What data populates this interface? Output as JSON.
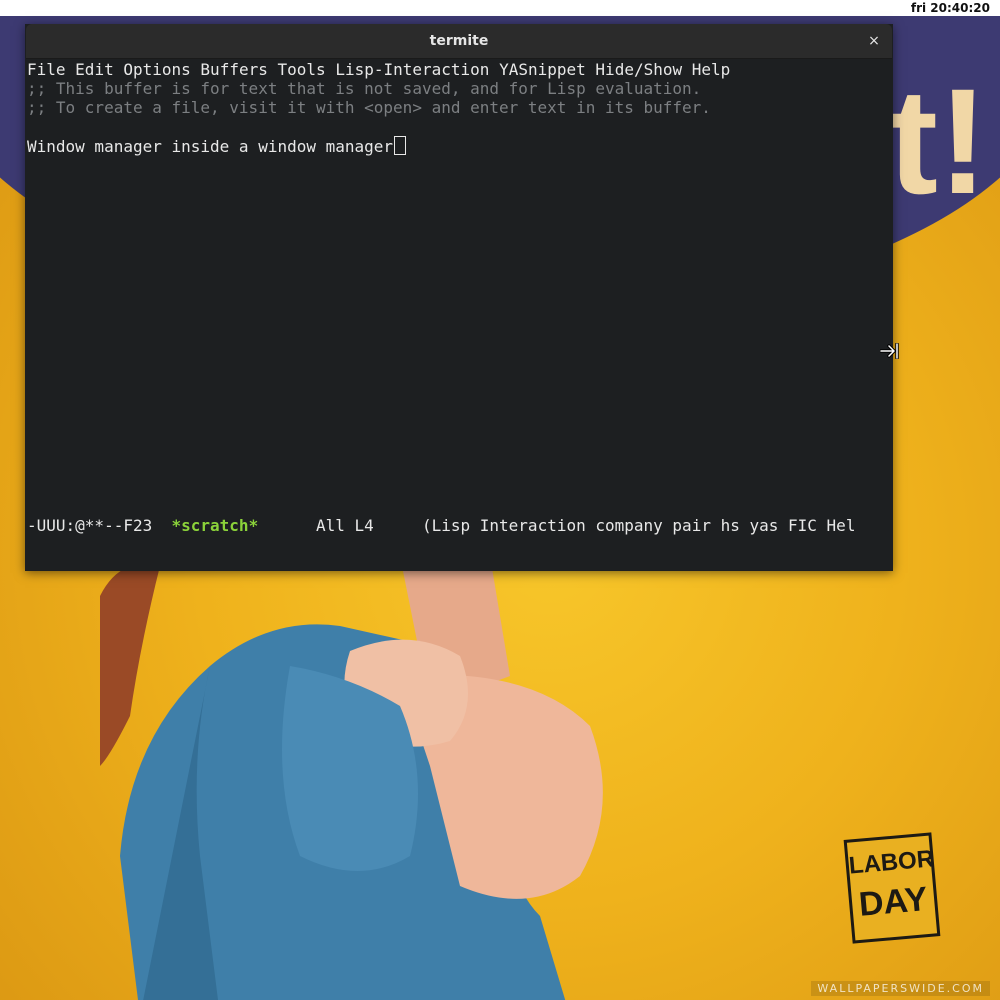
{
  "top_bar": {
    "clock": "fri 20:40:20"
  },
  "window": {
    "title": "termite",
    "close_glyph": "×"
  },
  "emacs": {
    "menu": [
      "File",
      "Edit",
      "Options",
      "Buffers",
      "Tools",
      "Lisp-Interaction",
      "YASnippet",
      "Hide/Show",
      "Help"
    ],
    "comments": [
      ";; This buffer is for text that is not saved, and for Lisp evaluation.",
      ";; To create a file, visit it with <open> and enter text in its buffer."
    ],
    "buffer_text": "Window manager inside a window manager",
    "mode_line": {
      "status": "-UUU:@**--F23  ",
      "buffer_name": "*scratch*",
      "position": "      All L4     ",
      "modes": "(Lisp Interaction company pair hs yas FIC Hel"
    }
  },
  "wallpaper": {
    "slogan_fragment": "t!",
    "badge_line1": "LABOR",
    "badge_line2": "DAY",
    "watermark": "WALLPAPERSWIDE.COM"
  },
  "colors": {
    "terminal_bg": "#1d1f21",
    "comment": "#7c7f82",
    "buffer_name": "#8bd23a",
    "wallpaper_yellow": "#efb21c",
    "wallpaper_navy": "#3d3a72"
  },
  "icons": {
    "pointer": "resize-right-cursor-icon",
    "close": "close-icon"
  }
}
